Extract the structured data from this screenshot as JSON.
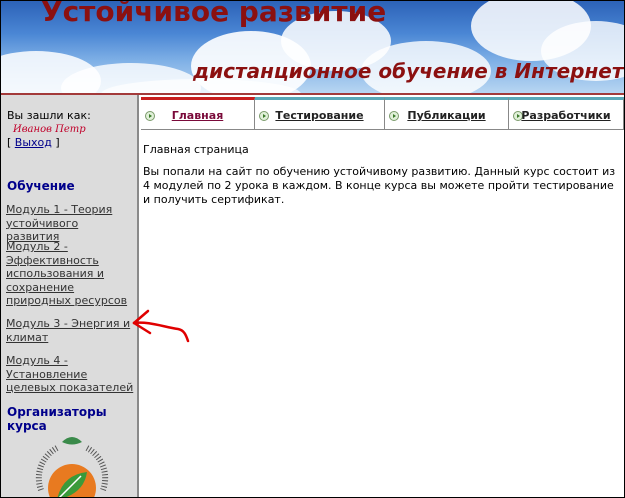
{
  "header": {
    "title": "Устойчивое развитие",
    "subtitle": "дистанционное обучение в Интернет"
  },
  "sidebar": {
    "login_caption": "Вы зашли как:",
    "user_name": "Иванов Петр",
    "logout": {
      "open": "[ ",
      "label": "Выход",
      "close": " ]"
    },
    "learning_heading": "Обучение",
    "modules": [
      {
        "label": "Модуль 1 - Теория устойчивого развития"
      },
      {
        "label": "Модуль 2 - Эффективность использования и сохранение природных ресурсов"
      },
      {
        "label": "Модуль 3 - Энергия и климат"
      },
      {
        "label": "Модуль 4 - Установление целевых показателей"
      }
    ],
    "organizers_heading": "Организаторы курса"
  },
  "tabs": [
    {
      "label": "Главная",
      "active": true
    },
    {
      "label": "Тестирование",
      "active": false
    },
    {
      "label": "Публикации",
      "active": false
    },
    {
      "label": "Разработчики",
      "active": false
    }
  ],
  "main": {
    "page_heading": "Главная страница",
    "intro": "Вы попали на сайт по обучению устойчивому развитию. Данный курс состоит из 4 модулей по 2 урока в каждом. В конце курса вы можете пройти тестирование и получить сертификат."
  },
  "colors": {
    "title": "#8b1010",
    "sidebar_bg": "#dcdcdc",
    "heading_blue": "#00008b",
    "active_tab": "#c81e1e",
    "tab_accent": "#5ba8b8",
    "annotation_arrow": "#e00000"
  }
}
